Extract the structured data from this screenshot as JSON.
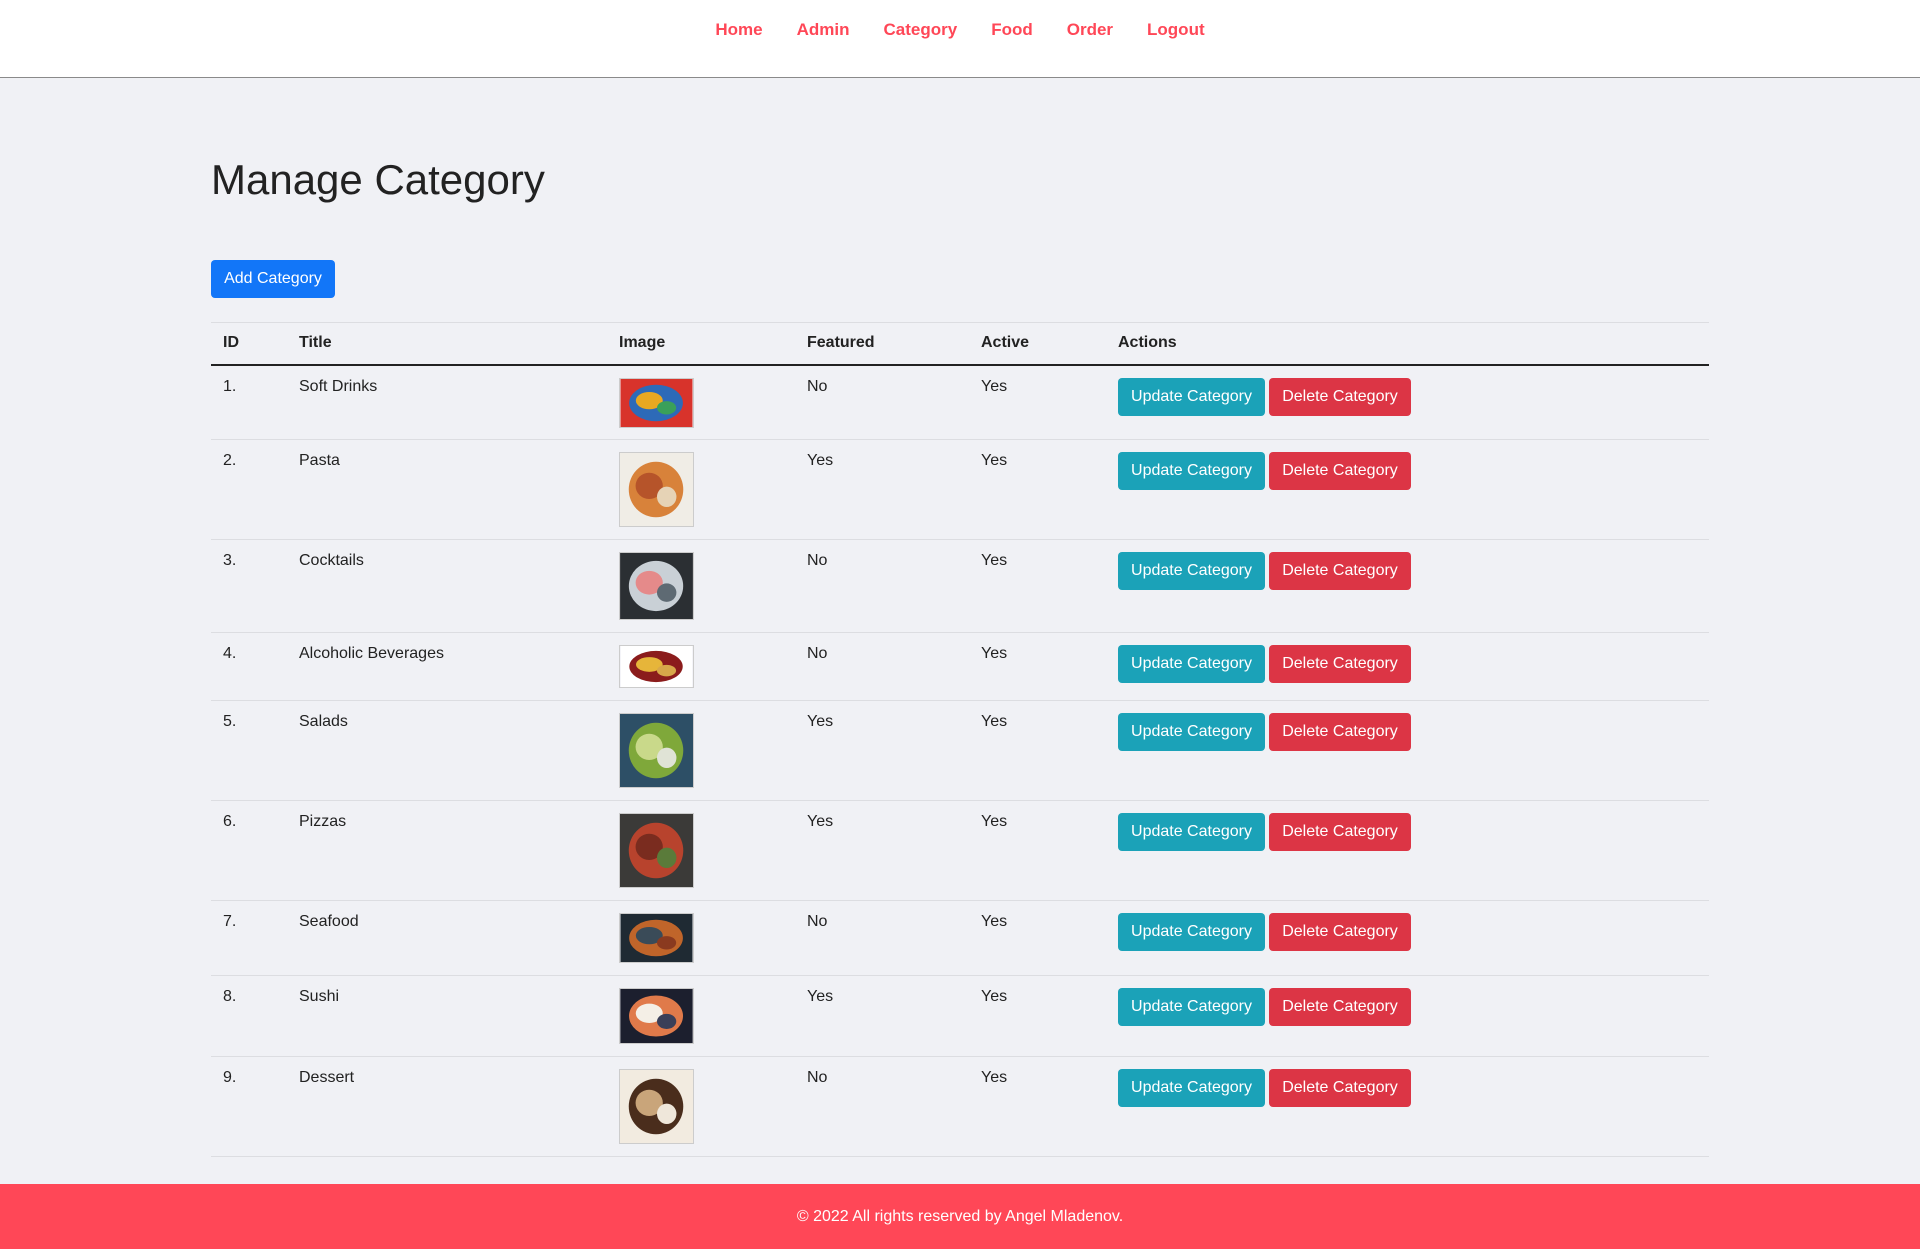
{
  "nav": {
    "items": [
      "Home",
      "Admin",
      "Category",
      "Food",
      "Order",
      "Logout"
    ]
  },
  "page": {
    "title": "Manage Category",
    "add_button": "Add Category"
  },
  "table": {
    "headers": [
      "ID",
      "Title",
      "Image",
      "Featured",
      "Active",
      "Actions"
    ],
    "update_label": "Update Category",
    "delete_label": "Delete Category",
    "rows": [
      {
        "id": "1.",
        "title": "Soft Drinks",
        "image": "soft-drinks-image",
        "featured": "No",
        "active": "Yes",
        "colors": [
          "#d8332b",
          "#2d6ab8",
          "#e9a821",
          "#3aa05a"
        ]
      },
      {
        "id": "2.",
        "title": "Pasta",
        "image": "pasta-image",
        "featured": "Yes",
        "active": "Yes",
        "colors": [
          "#f0ede6",
          "#d8823a",
          "#b6542a",
          "#e6d3b6"
        ]
      },
      {
        "id": "3.",
        "title": "Cocktails",
        "image": "cocktails-image",
        "featured": "No",
        "active": "Yes",
        "colors": [
          "#2b2f33",
          "#c9d0d6",
          "#e58a8a",
          "#5e6a73"
        ]
      },
      {
        "id": "4.",
        "title": "Alcoholic Beverages",
        "image": "alcoholic-beverages-image",
        "featured": "No",
        "active": "Yes",
        "colors": [
          "#ffffff",
          "#8b1c1c",
          "#e6b53a",
          "#d8a84a"
        ]
      },
      {
        "id": "5.",
        "title": "Salads",
        "image": "salads-image",
        "featured": "Yes",
        "active": "Yes",
        "colors": [
          "#2d4f66",
          "#7fa83a",
          "#c9d98a",
          "#e0e3d6"
        ]
      },
      {
        "id": "6.",
        "title": "Pizzas",
        "image": "pizzas-image",
        "featured": "Yes",
        "active": "Yes",
        "colors": [
          "#3b3a38",
          "#b8432d",
          "#7a2c1f",
          "#5a7b3a"
        ]
      },
      {
        "id": "7.",
        "title": "Seafood",
        "image": "seafood-image",
        "featured": "No",
        "active": "Yes",
        "colors": [
          "#1f2a33",
          "#c0652a",
          "#3a4b58",
          "#8a3a1f"
        ]
      },
      {
        "id": "8.",
        "title": "Sushi",
        "image": "sushi-image",
        "featured": "Yes",
        "active": "Yes",
        "colors": [
          "#1c1f2e",
          "#e07a4a",
          "#f4efe6",
          "#3a3f58"
        ]
      },
      {
        "id": "9.",
        "title": "Dessert",
        "image": "dessert-image",
        "featured": "No",
        "active": "Yes",
        "colors": [
          "#f2ebe0",
          "#4a2d1c",
          "#c9a57a",
          "#efe7da"
        ]
      }
    ]
  },
  "footer": {
    "text": "© 2022 All rights reserved by Angel Mladenov."
  },
  "colors": {
    "accent": "#ff4757",
    "primary": "#1276f8",
    "update": "#1ba2b8",
    "delete": "#dc3545",
    "background": "#f0f1f5"
  }
}
